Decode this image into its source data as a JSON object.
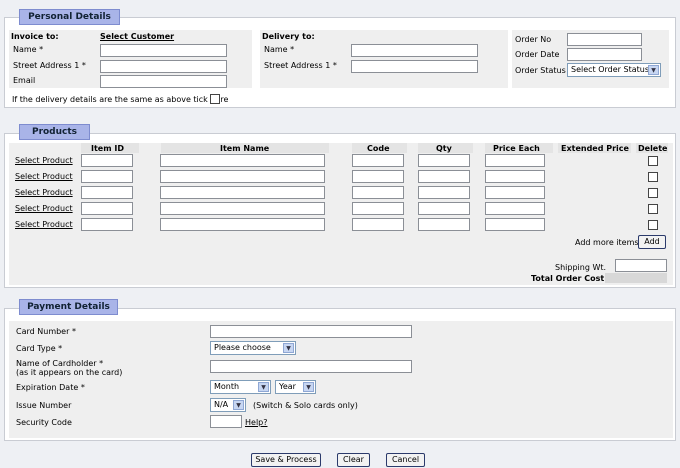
{
  "personal": {
    "legend": "Personal Details",
    "invoice_to": "Invoice to:",
    "select_customer": "Select Customer",
    "name_label": "Name *",
    "street_label": "Street Address 1 *",
    "email_label": "Email",
    "delivery_to": "Delivery to:",
    "d_name_label": "Name *",
    "d_street_label": "Street Address 1 *",
    "order_no_label": "Order No",
    "order_date_label": "Order Date",
    "order_status_label": "Order Status",
    "order_status_value": "Select Order Status",
    "same_delivery_label": "If the delivery details are the same as above tick here"
  },
  "products": {
    "legend": "Products",
    "headers": [
      "Item ID",
      "Item Name",
      "Code",
      "Qty",
      "Price Each",
      "Extended Price",
      "Delete"
    ],
    "rows": [
      {
        "link": "Select Product"
      },
      {
        "link": "Select Product"
      },
      {
        "link": "Select Product"
      },
      {
        "link": "Select Product"
      },
      {
        "link": "Select Product"
      }
    ],
    "add_more_label": "Add more items?",
    "add_button": "Add",
    "shipping_label": "Shipping Wt.",
    "total_label": "Total Order Cost"
  },
  "payment": {
    "legend": "Payment Details",
    "card_number_label": "Card Number *",
    "card_type_label": "Card Type *",
    "card_type_value": "Please choose",
    "cardholder_label": "Name of Cardholder *",
    "cardholder_sub": "(as it appears on the card)",
    "expiration_label": "Expiration Date *",
    "month_value": "Month",
    "year_value": "Year",
    "issue_label": "Issue Number",
    "issue_value": "N/A",
    "issue_note": "(Switch & Solo cards only)",
    "security_label": "Security Code",
    "help_link": "Help?"
  },
  "actions": {
    "save": "Save & Process",
    "clear": "Clear",
    "cancel": "Cancel"
  }
}
